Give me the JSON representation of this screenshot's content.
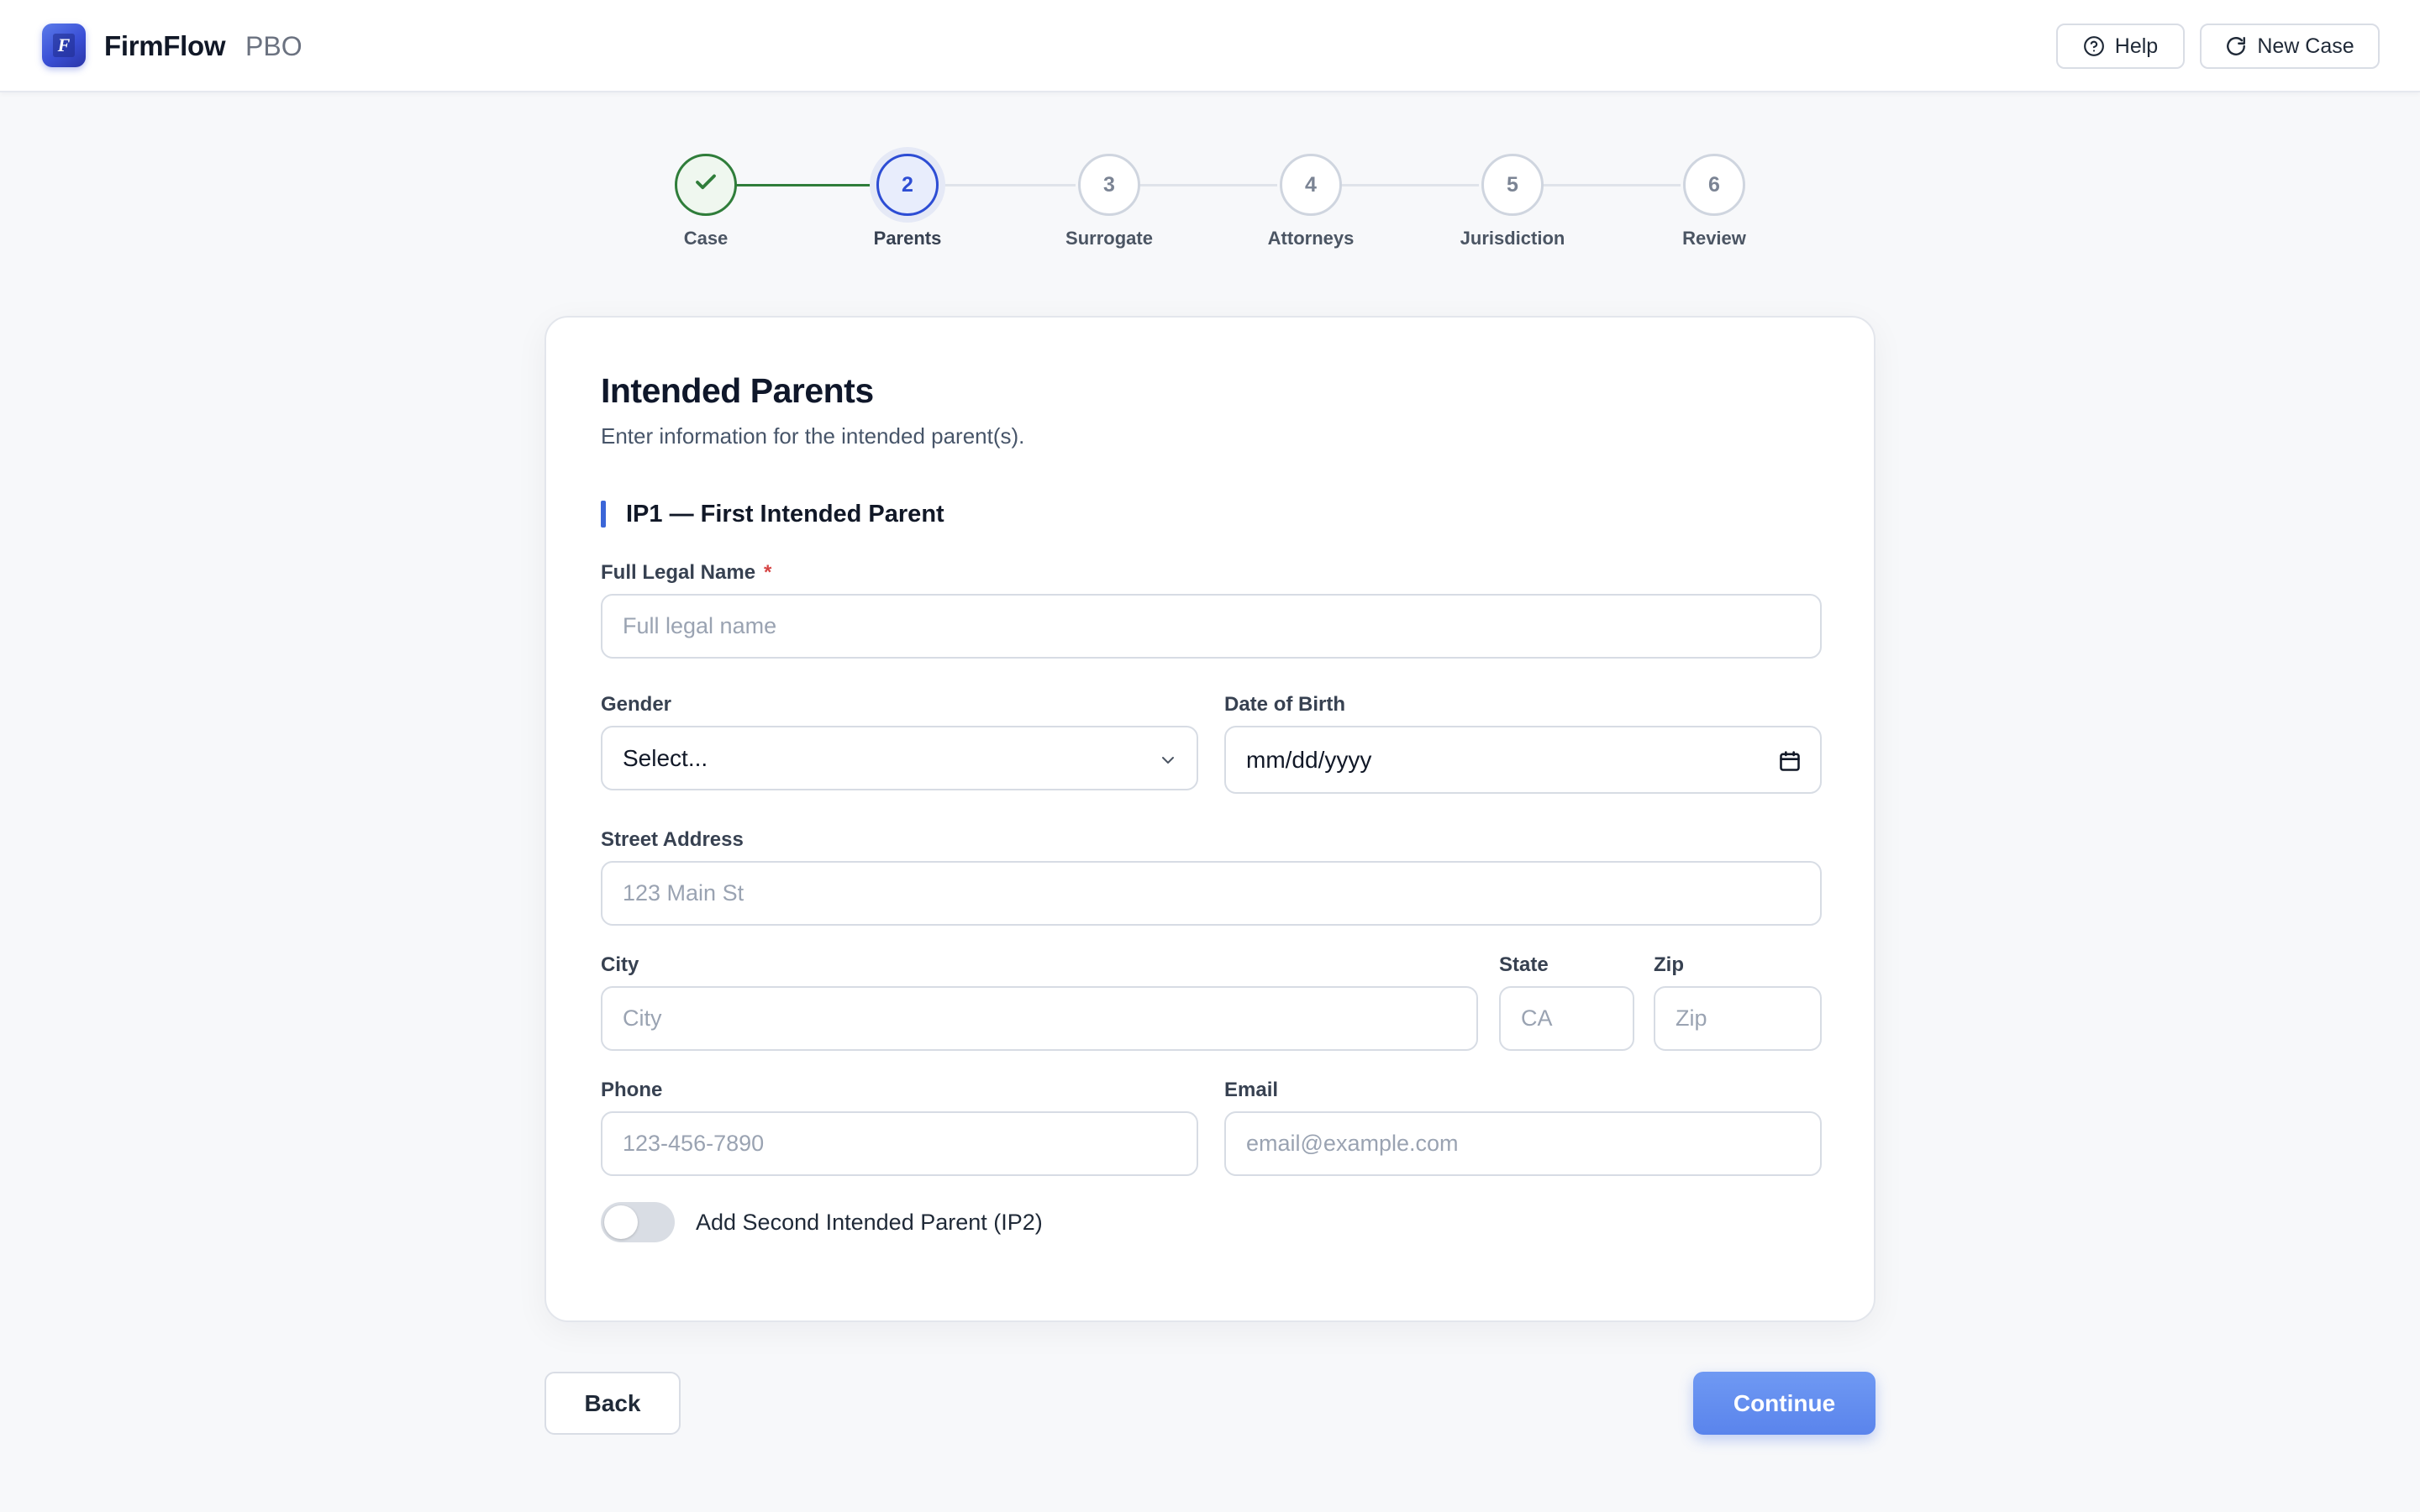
{
  "header": {
    "brand": "FirmFlow",
    "brand_sub": "PBO",
    "logo_letter": "F",
    "help_label": "Help",
    "new_case_label": "New Case"
  },
  "stepper": {
    "current": 2,
    "steps": [
      {
        "number": "",
        "label": "Case",
        "status": "done"
      },
      {
        "number": "2",
        "label": "Parents",
        "status": "active"
      },
      {
        "number": "3",
        "label": "Surrogate",
        "status": "pending"
      },
      {
        "number": "4",
        "label": "Attorneys",
        "status": "pending"
      },
      {
        "number": "5",
        "label": "Jurisdiction",
        "status": "pending"
      },
      {
        "number": "6",
        "label": "Review",
        "status": "pending"
      }
    ]
  },
  "form": {
    "title": "Intended Parents",
    "subtitle": "Enter information for the intended parent(s).",
    "section_title": "IP1 — First Intended Parent",
    "full_name": {
      "label": "Full Legal Name",
      "required_mark": "*",
      "placeholder": "Full legal name",
      "value": ""
    },
    "gender": {
      "label": "Gender",
      "value": "Select..."
    },
    "dob": {
      "label": "Date of Birth",
      "value": "mm/dd/yyyy"
    },
    "street": {
      "label": "Street Address",
      "placeholder": "123 Main St",
      "value": ""
    },
    "city": {
      "label": "City",
      "placeholder": "City",
      "value": ""
    },
    "state": {
      "label": "State",
      "placeholder": "CA",
      "value": ""
    },
    "zip": {
      "label": "Zip",
      "placeholder": "Zip",
      "value": ""
    },
    "phone": {
      "label": "Phone",
      "placeholder": "123-456-7890",
      "value": ""
    },
    "email": {
      "label": "Email",
      "placeholder": "email@example.com",
      "value": ""
    },
    "ip2_toggle": {
      "label": "Add Second Intended Parent (IP2)",
      "checked": false
    }
  },
  "footer": {
    "back_label": "Back",
    "continue_label": "Continue"
  },
  "colors": {
    "accent": "#2d4dd4",
    "done_green": "#2f7d3a",
    "continue_blue": "#5a84ec"
  }
}
